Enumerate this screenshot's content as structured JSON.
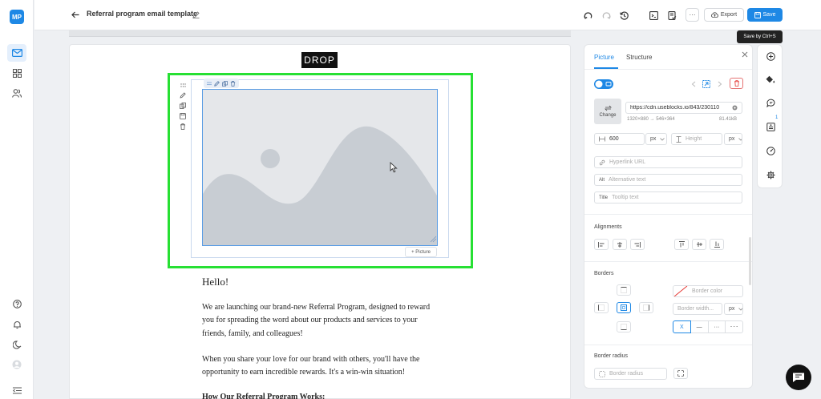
{
  "app": {
    "logo": "MP"
  },
  "header": {
    "title": "Referral program email template",
    "more_label": "···",
    "export_label": "Export",
    "save_label": "Save",
    "save_tooltip": "Save by Ctrl+S"
  },
  "canvas": {
    "logo_text": "DROP",
    "picture_tag": "+ Picture",
    "greeting": "Hello!",
    "paragraph1": "We are launching our brand-new Referral Program, designed to reward you for spreading the word about our products and services to your friends, family, and colleagues!",
    "paragraph2": "When you share your love for our brand with others, you'll have the opportunity to earn incredible rewards. It's a win-win situation!",
    "paragraph3": "How Our Referral Program Works:"
  },
  "panel": {
    "tabs": [
      {
        "label": "Picture",
        "active": true
      },
      {
        "label": "Structure",
        "active": false
      }
    ],
    "image": {
      "change_label": "Change",
      "url": "https://cdn.useblocks.io/843/230110",
      "dimensions": "1320×880 → 546×364",
      "size": "81.41kB"
    },
    "width": {
      "value": "600",
      "unit": "px"
    },
    "height": {
      "placeholder": "Height",
      "unit": "px"
    },
    "hyperlink_placeholder": "Hyperlink URL",
    "alt_prefix": "Alt",
    "alt_placeholder": "Alternative text",
    "title_prefix": "Title",
    "title_placeholder": "Tooltip text",
    "alignments_label": "Alignments",
    "borders_label": "Borders",
    "border_color_placeholder": "Border color",
    "border_width_placeholder": "Border width...",
    "border_width_unit": "px",
    "border_radius_label": "Border radius",
    "border_radius_placeholder": "Border radius",
    "style_none": "X",
    "style_solid": "—",
    "style_dotted": "···",
    "style_dashed": "- - -"
  },
  "right_rail": {
    "badge_count": "1"
  },
  "colors": {
    "accent": "#1e88e5",
    "selection": "#27e033",
    "placeholder_bg": "#e5e7ea",
    "placeholder_shape": "#c8cdd3"
  }
}
